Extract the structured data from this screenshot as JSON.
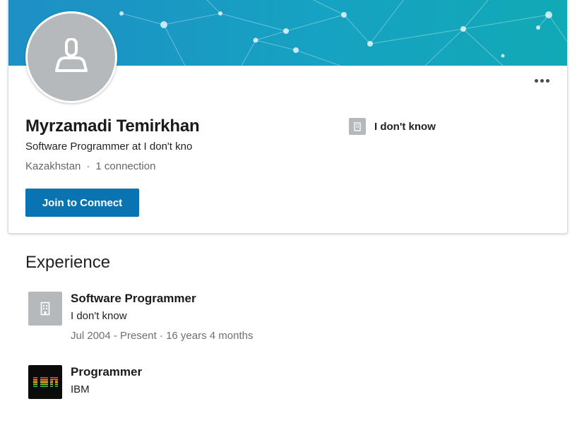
{
  "profile": {
    "name": "Myrzamadi Temirkhan",
    "headline": "Software Programmer at I don't kno",
    "location": "Kazakhstan",
    "connections": "1 connection",
    "separator": "·",
    "connect_button": "Join to Connect",
    "current_company": "I don't know",
    "avatar_icon": "person-placeholder-icon",
    "more_icon": "more-options-icon"
  },
  "experience": {
    "title": "Experience",
    "items": [
      {
        "title": "Software Programmer",
        "company": "I don't know",
        "dates": "Jul 2004 - Present · 16 years 4 months",
        "logo_icon": "company-placeholder-icon"
      },
      {
        "title": "Programmer",
        "company": "IBM",
        "logo_icon": "ibm-logo"
      }
    ]
  },
  "colors": {
    "accent": "#0a73b1",
    "banner_start": "#1e8fc5",
    "banner_end": "#11a9b6",
    "placeholder_gray": "#b6b9bc"
  }
}
